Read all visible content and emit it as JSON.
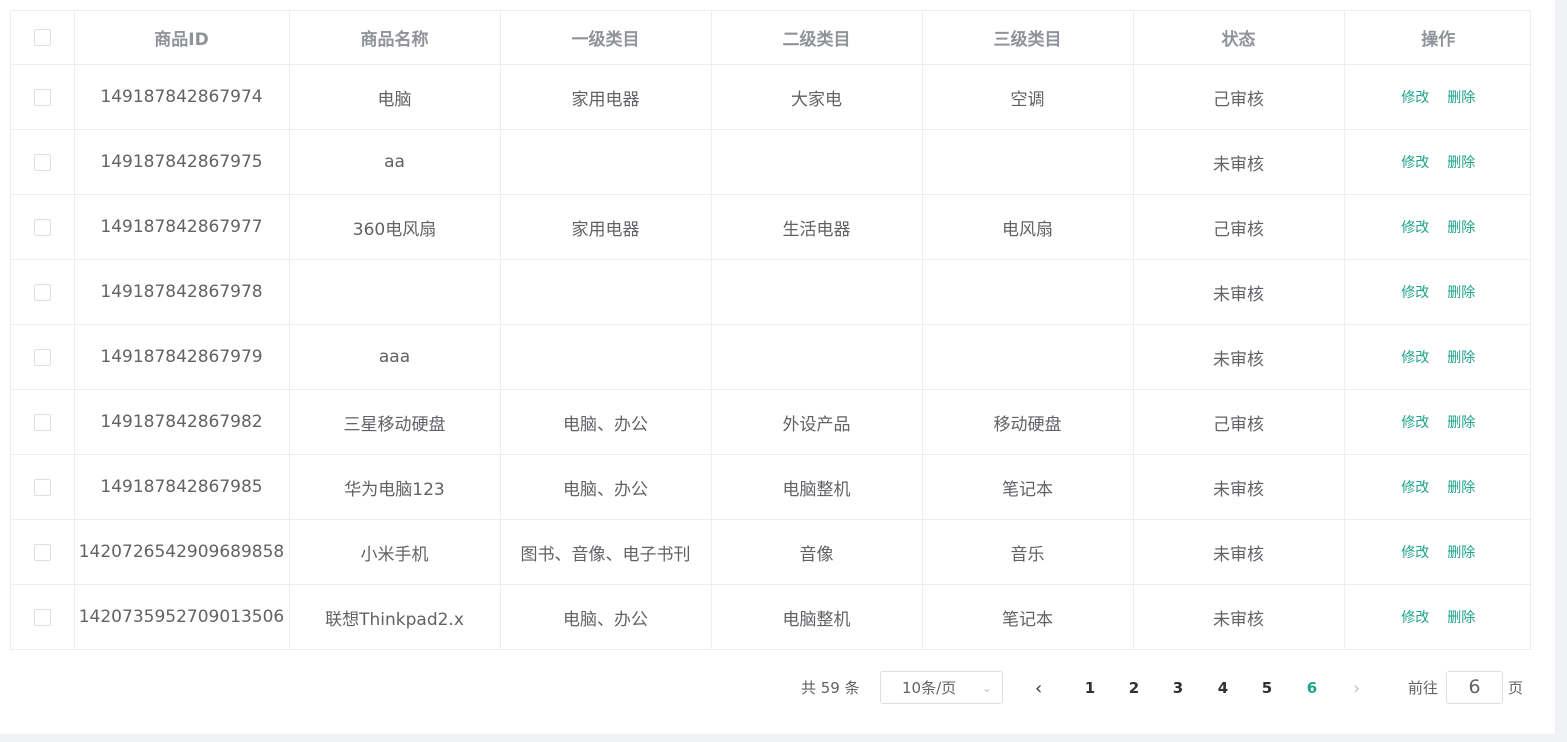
{
  "columns": [
    "商品ID",
    "商品名称",
    "一级类目",
    "二级类目",
    "三级类目",
    "状态",
    "操作"
  ],
  "actions": {
    "edit": "修改",
    "delete": "删除"
  },
  "rows": [
    {
      "id": "149187842867974",
      "name": "电脑",
      "cat1": "家用电器",
      "cat2": "大家电",
      "cat3": "空调",
      "status": "己审核"
    },
    {
      "id": "149187842867975",
      "name": "aa",
      "cat1": "",
      "cat2": "",
      "cat3": "",
      "status": "未审核"
    },
    {
      "id": "149187842867977",
      "name": "360电风扇",
      "cat1": "家用电器",
      "cat2": "生活电器",
      "cat3": "电风扇",
      "status": "己审核"
    },
    {
      "id": "149187842867978",
      "name": "",
      "cat1": "",
      "cat2": "",
      "cat3": "",
      "status": "未审核"
    },
    {
      "id": "149187842867979",
      "name": "aaa",
      "cat1": "",
      "cat2": "",
      "cat3": "",
      "status": "未审核"
    },
    {
      "id": "149187842867982",
      "name": "三星移动硬盘",
      "cat1": "电脑、办公",
      "cat2": "外设产品",
      "cat3": "移动硬盘",
      "status": "己审核"
    },
    {
      "id": "149187842867985",
      "name": "华为电脑123",
      "cat1": "电脑、办公",
      "cat2": "电脑整机",
      "cat3": "笔记本",
      "status": "未审核"
    },
    {
      "id": "1420726542909689858",
      "name": "小米手机",
      "cat1": "图书、音像、电子书刊",
      "cat2": "音像",
      "cat3": "音乐",
      "status": "未审核"
    },
    {
      "id": "1420735952709013506",
      "name": "联想Thinkpad2.x",
      "cat1": "电脑、办公",
      "cat2": "电脑整机",
      "cat3": "笔记本",
      "status": "未审核"
    }
  ],
  "pagination": {
    "total_text": "共 59 条",
    "page_size": "10条/页",
    "pages": [
      "1",
      "2",
      "3",
      "4",
      "5",
      "6"
    ],
    "current_page": "6",
    "goto_label": "前往",
    "goto_value": "6",
    "goto_suffix": "页"
  },
  "colors": {
    "accent": "#1fa38b",
    "border": "#ebeef5",
    "header_text": "#909399"
  },
  "icons": {
    "prev": "chevron-left-icon",
    "next": "chevron-right-icon",
    "select": "chevron-down-icon"
  }
}
